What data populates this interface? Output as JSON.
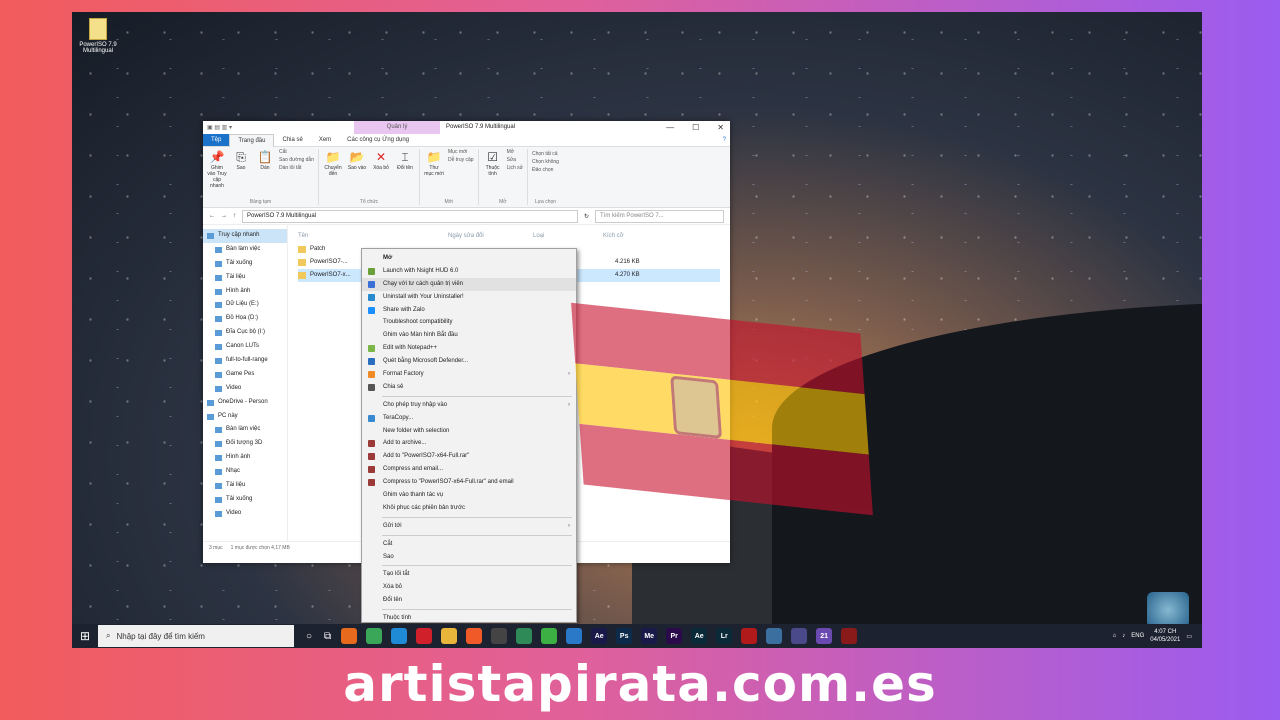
{
  "desktop": {
    "icon_label": "PowerISO 7.9 Multilingual"
  },
  "explorer": {
    "context_tab": "Quản lý",
    "title": "PowerISO 7.9 Multilingual",
    "tabs": [
      "Tệp",
      "Trang đầu",
      "Chia sẻ",
      "Xem",
      "Các công cụ Ứng dụng"
    ],
    "ribbon": {
      "clipboard": {
        "pin": "Ghim vào Truy cập nhanh",
        "copy": "Sao",
        "paste": "Dán",
        "cut": "Cắt",
        "copy_path": "Sao đường dẫn",
        "paste_shortcut": "Dán lối tắt",
        "label": "Bảng tạm"
      },
      "organize": {
        "move": "Chuyển đến",
        "copy": "Sao vào",
        "delete": "Xóa bỏ",
        "rename": "Đổi tên",
        "label": "Tổ chức"
      },
      "new": {
        "folder": "Thư mục mới",
        "new_item": "Mục mới",
        "easy_access": "Dễ truy cập",
        "label": "Mới"
      },
      "open": {
        "properties": "Thuộc tính",
        "open": "Mở",
        "edit": "Sửa",
        "history": "Lịch sử",
        "label": "Mở"
      },
      "select": {
        "all": "Chọn tất cả",
        "none": "Chọn không",
        "invert": "Đảo chọn",
        "label": "Lựa chọn"
      }
    },
    "path": "PowerISO 7.9 Multilingual",
    "search_placeholder": "Tìm kiếm PowerISO 7...",
    "nav": [
      {
        "label": "Truy cập nhanh",
        "top": true,
        "sel": true
      },
      {
        "label": "Bàn làm việc"
      },
      {
        "label": "Tải xuống"
      },
      {
        "label": "Tài liệu"
      },
      {
        "label": "Hình ảnh"
      },
      {
        "label": "Dữ Liệu (E:)"
      },
      {
        "label": "Đồ Họa (D:)"
      },
      {
        "label": "Đĩa Cục bộ (I:)"
      },
      {
        "label": "Canon LUTs"
      },
      {
        "label": "full-to-full-range"
      },
      {
        "label": "Game Pes"
      },
      {
        "label": "Video"
      },
      {
        "label": "OneDrive - Person",
        "top": true
      },
      {
        "label": "PC này",
        "top": true
      },
      {
        "label": "Bàn làm việc"
      },
      {
        "label": "Đối tượng 3D"
      },
      {
        "label": "Hình ảnh"
      },
      {
        "label": "Nhạc"
      },
      {
        "label": "Tài liệu"
      },
      {
        "label": "Tải xuống"
      },
      {
        "label": "Video"
      }
    ],
    "columns": [
      "Tên",
      "Ngày sửa đổi",
      "Loại",
      "Kích cỡ"
    ],
    "files": [
      {
        "name": "Patch",
        "size": "",
        "sel": false
      },
      {
        "name": "PowerISO7-...",
        "size": "4.216 KB",
        "sel": false
      },
      {
        "name": "PowerISO7-x...",
        "size": "4.270 KB",
        "sel": true
      }
    ],
    "status": {
      "count": "3 mục",
      "selected": "1 mục được chọn  4,17 MB"
    }
  },
  "context_menu": [
    {
      "label": "Mở",
      "bold": true
    },
    {
      "label": "Launch with Nsight HUD 6.0",
      "icon": "#6a9f3a"
    },
    {
      "label": "Chạy với tư cách quản trị viên",
      "icon": "#3a6fd8",
      "hl": true
    },
    {
      "label": "Uninstall with Your Uninstaller!",
      "icon": "#2a8ad0"
    },
    {
      "label": "Share with Zalo",
      "icon": "#1a8fff"
    },
    {
      "label": "Troubleshoot compatibility"
    },
    {
      "label": "Ghim vào Màn hình Bắt đầu"
    },
    {
      "label": "Edit with Notepad++",
      "icon": "#7ab648"
    },
    {
      "label": "Quét bằng Microsoft Defender...",
      "icon": "#2a6fbf"
    },
    {
      "label": "Format Factory",
      "icon": "#f08a24",
      "arrow": true
    },
    {
      "label": "Chia sẻ",
      "icon": "#555555"
    },
    {
      "sep": true
    },
    {
      "label": "Cho phép truy nhập vào",
      "arrow": true
    },
    {
      "label": "TeraCopy...",
      "icon": "#3a8ad0"
    },
    {
      "label": "New folder with selection"
    },
    {
      "label": "Add to archive...",
      "icon": "#9c3a3a"
    },
    {
      "label": "Add to \"PowerISO7-x64-Full.rar\"",
      "icon": "#9c3a3a"
    },
    {
      "label": "Compress and email...",
      "icon": "#9c3a3a"
    },
    {
      "label": "Compress to \"PowerISO7-x64-Full.rar\" and email",
      "icon": "#9c3a3a"
    },
    {
      "label": "Ghim vào thanh tác vụ"
    },
    {
      "label": "Khôi phục các phiên bản trước"
    },
    {
      "sep": true
    },
    {
      "label": "Gửi tới",
      "arrow": true
    },
    {
      "sep": true
    },
    {
      "label": "Cắt"
    },
    {
      "label": "Sao"
    },
    {
      "sep": true
    },
    {
      "label": "Tạo lối tắt"
    },
    {
      "label": "Xóa bỏ"
    },
    {
      "label": "Đổi tên"
    },
    {
      "sep": true
    },
    {
      "label": "Thuộc tính"
    }
  ],
  "taskbar": {
    "search_placeholder": "Nhập tại đây để tìm kiếm",
    "apps": [
      {
        "name": "firefox-icon",
        "color": "#e86a1c",
        "text": ""
      },
      {
        "name": "chrome-icon",
        "color": "#3aa657",
        "text": ""
      },
      {
        "name": "edge-icon",
        "color": "#1f8bd6",
        "text": ""
      },
      {
        "name": "opera-icon",
        "color": "#d0202a",
        "text": ""
      },
      {
        "name": "file-explorer-icon",
        "color": "#e9b53a",
        "text": ""
      },
      {
        "name": "brave-icon",
        "color": "#f05a28",
        "text": ""
      },
      {
        "name": "media-icon",
        "color": "#444",
        "text": ""
      },
      {
        "name": "tool-icon",
        "color": "#2e8b57",
        "text": ""
      },
      {
        "name": "camtasia-icon",
        "color": "#3cb043",
        "text": ""
      },
      {
        "name": "app-icon",
        "color": "#2a78c8",
        "text": ""
      },
      {
        "name": "after-effects-icon",
        "color": "#1a1a4a",
        "text": "Ae"
      },
      {
        "name": "photoshop-icon",
        "color": "#0c2a4a",
        "text": "Ps"
      },
      {
        "name": "media-encoder-icon",
        "color": "#1a1a4a",
        "text": "Me"
      },
      {
        "name": "premiere-icon",
        "color": "#2a0a4a",
        "text": "Pr"
      },
      {
        "name": "audition-icon",
        "color": "#0a2a3a",
        "text": "Ae"
      },
      {
        "name": "lightroom-icon",
        "color": "#0a2a3a",
        "text": "Lr"
      },
      {
        "name": "acrobat-icon",
        "color": "#b01a1a",
        "text": ""
      },
      {
        "name": "network-icon",
        "color": "#3a6fa0",
        "text": ""
      },
      {
        "name": "snip-icon",
        "color": "#4a4a8a",
        "text": ""
      },
      {
        "name": "teams-icon",
        "color": "#6a4ab0",
        "text": "21"
      },
      {
        "name": "app2-icon",
        "color": "#8a1a1a",
        "text": ""
      }
    ],
    "lang": "ENG",
    "time": "4:07 CH",
    "date": "04/05/2021"
  },
  "watermark": "artistapirata.com.es",
  "flag": {
    "colors": [
      "#c8102e",
      "#ffc400",
      "#c8102e"
    ]
  }
}
